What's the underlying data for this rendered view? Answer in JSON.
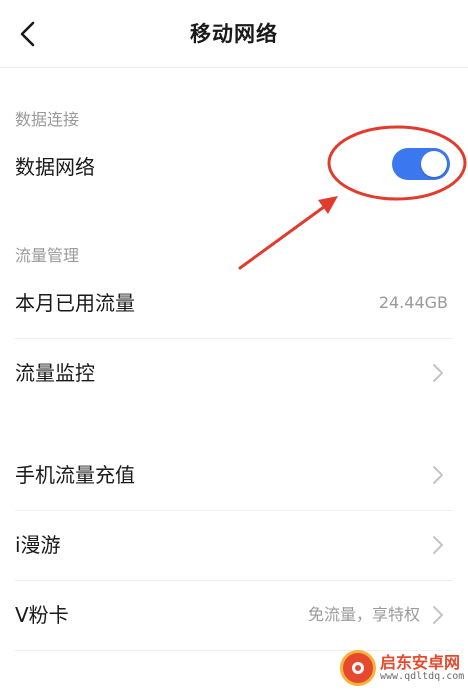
{
  "header": {
    "title": "移动网络"
  },
  "sections": {
    "data_connection": {
      "title": "数据连接"
    },
    "traffic_management": {
      "title": "流量管理"
    }
  },
  "rows": {
    "data_network": {
      "label": "数据网络",
      "enabled": true
    },
    "monthly_usage": {
      "label": "本月已用流量",
      "value": "24.44GB"
    },
    "traffic_monitor": {
      "label": "流量监控"
    },
    "mobile_recharge": {
      "label": "手机流量充值"
    },
    "iroaming": {
      "label": "i漫游"
    },
    "vcard": {
      "label": "V粉卡",
      "value": "免流量，享特权"
    }
  },
  "colors": {
    "toggle_on": "#3b78f0",
    "annotation": "#e23b2e",
    "secondary_text": "#9a9a9a"
  },
  "icons": {
    "back": "chevron-left-icon",
    "row_arrow": "chevron-right-icon"
  },
  "watermark": {
    "title": "启东安卓网",
    "url": "www.qdltdq.com"
  }
}
